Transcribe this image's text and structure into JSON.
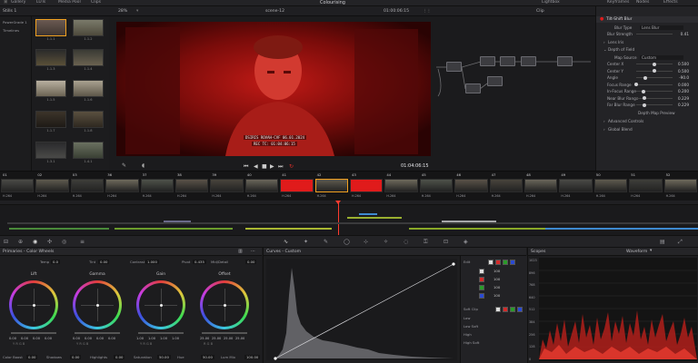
{
  "top_menu": [
    "Gallery",
    "LUTs",
    "Media Pool",
    "Clips"
  ],
  "app_title": "Colourising",
  "top_right": [
    "Lightbox",
    "Keyframes",
    "Nodes",
    "Effects"
  ],
  "toolbar": {
    "album": "Stills 1",
    "zoom": "28%",
    "clip_name": "scene-12",
    "timecode": "01:00:06:15",
    "clip_mode": "Clip",
    "library_tab": "Library",
    "settings_tab": "Settings"
  },
  "gallery": {
    "albums": [
      "PowerGrade 1",
      "Timelines"
    ],
    "stills": [
      "1.1.1",
      "1.1.2",
      "1.1.3",
      "1.1.4",
      "1.1.5",
      "1.1.6",
      "1.1.7",
      "1.1.8",
      "1.3.1",
      "1.4.1",
      "1.5.1",
      "1.6.1"
    ],
    "selected_index": 0
  },
  "viewer": {
    "burnin_line1": "DSIRIS ROVAH-CVF 06.01.2024",
    "burnin_line2": "REC TC: 01:04:06:15",
    "timecode": "01:04:06:15"
  },
  "settings": {
    "effect_title": "Tilt-Shift Blur",
    "blur_type_label": "Blur Type",
    "blur_type": "Lens Blur",
    "blur_strength_label": "Blur Strength",
    "blur_strength": "0.41",
    "sections": [
      "Lens Iris",
      "Depth of Field"
    ],
    "map_source_label": "Map Source",
    "map_source": "Custom",
    "params": [
      {
        "label": "Center X",
        "value": "0.500",
        "level": 0.5
      },
      {
        "label": "Center Y",
        "value": "0.500",
        "level": 0.5
      },
      {
        "label": "Angle",
        "value": "-90.0",
        "level": 0.25
      },
      {
        "label": "Focus Range",
        "value": "0.000",
        "level": 0.0
      },
      {
        "label": "In-Focus Range",
        "value": "0.200",
        "level": 0.2
      },
      {
        "label": "Near Blur Range",
        "value": "0.229",
        "level": 0.23
      },
      {
        "label": "Far Blur Range",
        "value": "0.229",
        "level": 0.23
      }
    ],
    "depth_preview": "Depth Map Preview",
    "advanced": "Advanced Controls",
    "global_blend": "Global Blend"
  },
  "clips": [
    {
      "num": "01",
      "tc": "01:00:00:00",
      "codec": "H.264"
    },
    {
      "num": "02",
      "tc": "01:00:08:12",
      "codec": "H.264"
    },
    {
      "num": "03",
      "tc": "01:00:14:03",
      "codec": "H.264"
    },
    {
      "num": "36",
      "tc": "01:00:20:22",
      "codec": "H.264"
    },
    {
      "num": "37",
      "tc": "01:00:27:10",
      "codec": "H.264"
    },
    {
      "num": "38",
      "tc": "01:00:35:01",
      "codec": "H.264"
    },
    {
      "num": "39",
      "tc": "01:00:41:18",
      "codec": "H.264"
    },
    {
      "num": "40",
      "tc": "01:00:48:04",
      "codec": "H.264"
    },
    {
      "num": "41",
      "tc": "01:00:55:14",
      "codec": "H.264"
    },
    {
      "num": "42",
      "tc": "01:01:02:07",
      "codec": "H.264"
    },
    {
      "num": "43",
      "tc": "01:01:09:20",
      "codec": "H.264"
    },
    {
      "num": "44",
      "tc": "01:01:16:02",
      "codec": "H.264"
    },
    {
      "num": "45",
      "tc": "01:01:23:11",
      "codec": "H.264"
    },
    {
      "num": "46",
      "tc": "01:01:30:00",
      "codec": "H.264"
    },
    {
      "num": "47",
      "tc": "01:01:36:19",
      "codec": "H.264"
    },
    {
      "num": "48",
      "tc": "01:01:43:08",
      "codec": "H.264"
    },
    {
      "num": "49",
      "tc": "01:01:50:01",
      "codec": "H.264"
    },
    {
      "num": "50",
      "tc": "01:01:56:22",
      "codec": "H.264"
    },
    {
      "num": "51",
      "tc": "01:02:03:13",
      "codec": "H.264"
    },
    {
      "num": "52",
      "tc": "01:02:10:06",
      "codec": "H.264"
    }
  ],
  "color_wheels": {
    "title": "Primaries - Color Wheels",
    "temp_label": "Temp",
    "temp": "0.0",
    "tint_label": "Tint",
    "tint": "0.00",
    "contrast_label": "Contrast",
    "contrast": "1.000",
    "pivot_label": "Pivot",
    "pivot": "0.435",
    "middetail_label": "Mid/Detail",
    "middetail": "0.00",
    "wheels": [
      {
        "name": "Lift",
        "values": [
          "0.00",
          "0.00",
          "0.00",
          "0.00"
        ],
        "channels": "Y  R  G  B"
      },
      {
        "name": "Gamma",
        "values": [
          "0.00",
          "0.00",
          "0.00",
          "0.00"
        ],
        "channels": "Y  R  G  B"
      },
      {
        "name": "Gain",
        "values": [
          "1.00",
          "1.00",
          "1.00",
          "1.00"
        ],
        "channels": "Y  R  G  B"
      },
      {
        "name": "Offset",
        "values": [
          "25.00",
          "25.00",
          "25.00",
          "25.00"
        ],
        "channels": "R  G  B"
      }
    ],
    "bottom": [
      {
        "label": "Color Boost",
        "value": "0.00"
      },
      {
        "label": "Shadows",
        "value": "0.00"
      },
      {
        "label": "Highlights",
        "value": "0.00"
      },
      {
        "label": "Saturation",
        "value": "50.00"
      },
      {
        "label": "Hue",
        "value": "50.00"
      },
      {
        "label": "Lum Mix",
        "value": "100.00"
      }
    ]
  },
  "curves": {
    "title": "Curves - Custom",
    "edit_label": "Edit",
    "intensity": [
      "100",
      "100",
      "100",
      "100"
    ],
    "softclip_label": "Soft Clip",
    "softclip_rows": [
      "Low",
      "Low Soft",
      "High",
      "High Soft"
    ]
  },
  "scopes": {
    "title": "Scopes",
    "mode": "Waveform",
    "scale": [
      "1023",
      "896",
      "768",
      "640",
      "512",
      "384",
      "256",
      "128",
      "0"
    ]
  },
  "colors": {
    "accent_red": "#e01b1b",
    "selection_orange": "#f0a020",
    "playhead": "#ff3b2f"
  }
}
